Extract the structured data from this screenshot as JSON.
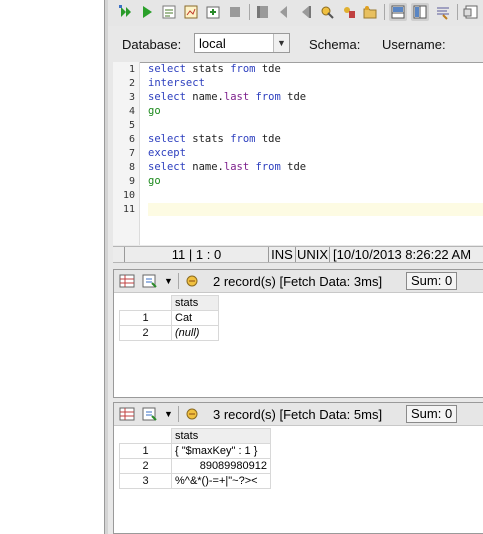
{
  "toolbar": {
    "icons": [
      "run-all-icon",
      "run-icon",
      "explain-icon",
      "plan-icon",
      "export-icon",
      "stop-icon",
      "prev-icon",
      "back-icon",
      "forward-icon",
      "history-icon",
      "bookmark-icon",
      "folder-icon",
      "layout-editor-icon",
      "layout-split-icon",
      "format-icon",
      "window-icon"
    ]
  },
  "connection": {
    "database_label": "Database:",
    "database_value": "local",
    "schema_label": "Schema:",
    "username_label": "Username:"
  },
  "editor": {
    "line_numbers": [
      "1",
      "2",
      "3",
      "4",
      "5",
      "6",
      "7",
      "8",
      "9",
      "10",
      "11"
    ],
    "lines": [
      {
        "kw1": "select",
        "txt1": " stats ",
        "kw2": "from",
        "txt2": " tde"
      },
      {
        "kw1": "intersect"
      },
      {
        "kw1": "select",
        "txt1": " name.",
        "fld": "last",
        "txt2a": " ",
        "kw2": "from",
        "txt2": " tde"
      },
      {
        "go": "go"
      },
      {},
      {
        "kw1": "select",
        "txt1": " stats ",
        "kw2": "from",
        "txt2": " tde"
      },
      {
        "kw1": "except"
      },
      {
        "kw1": "select",
        "txt1": " name.",
        "fld": "last",
        "txt2a": " ",
        "kw2": "from",
        "txt2": " tde"
      },
      {
        "go": "go"
      },
      {},
      {}
    ]
  },
  "status": {
    "position": "11 | 1 : 0",
    "mode": "INS",
    "line_ending": "UNIX",
    "timestamp": "[10/10/2013 8:26:22 AM"
  },
  "results": [
    {
      "summary": "2 record(s) [Fetch Data: 3ms]",
      "sum": "Sum: 0",
      "header": "stats",
      "rows": [
        {
          "n": "1",
          "v": "Cat"
        },
        {
          "n": "2",
          "v": "(null)"
        }
      ]
    },
    {
      "summary": "3 record(s) [Fetch Data: 5ms]",
      "sum": "Sum: 0",
      "header": "stats",
      "rows": [
        {
          "n": "1",
          "v": "{ \"$maxKey\" : 1 }"
        },
        {
          "n": "2",
          "v": "89089980912"
        },
        {
          "n": "3",
          "v": "%^&*()-=+|\"~?><"
        }
      ]
    }
  ]
}
